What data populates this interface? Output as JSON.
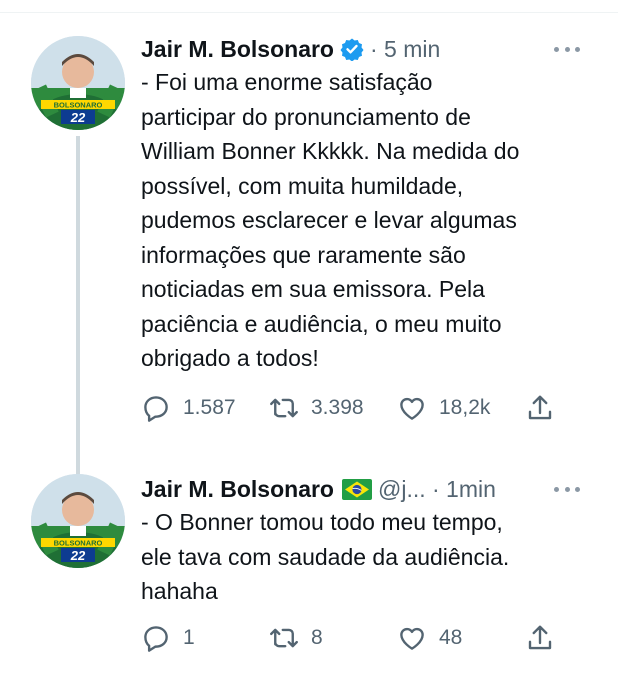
{
  "tweets": [
    {
      "author_name": "Jair M. Bolsonaro",
      "verified": true,
      "meta": "· 5 min",
      "text_lines": [
        "- Foi uma enorme satisfação",
        "participar do pronunciamento de",
        "William Bonner Kkkkk. Na medida do",
        "possível, com muita humildade,",
        "pudemos esclarecer e levar algumas",
        "informações que raramente são",
        "noticiadas em sua emissora. Pela",
        "paciência e audiência, o meu muito",
        "obrigado a todos!"
      ],
      "avatar_text": "BOLSONARO 22",
      "replies": "1.587",
      "retweets": "3.398",
      "likes": "18,2k"
    },
    {
      "author_name": "Jair M. Bolsonaro",
      "flag": "brazil-flag-icon",
      "meta": "@j... · 1min",
      "text_lines": [
        "- O Bonner tomou todo meu tempo,",
        "ele tava com saudade da audiência.",
        "hahaha"
      ],
      "avatar_text": "BOLSONARO 22",
      "replies": "1",
      "retweets": "8",
      "likes": "48"
    }
  ],
  "icons": {
    "reply": "reply-icon",
    "retweet": "retweet-icon",
    "like": "like-icon",
    "share": "share-icon",
    "more": "more-icon",
    "verified": "verified-badge-icon"
  },
  "colors": {
    "text": "#0f1419",
    "secondary": "#536471",
    "verified": "#1d9bf0",
    "thread_line": "#cfd9de"
  }
}
